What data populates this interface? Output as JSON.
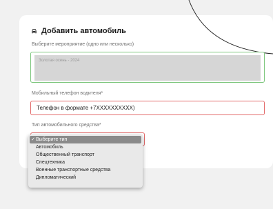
{
  "form": {
    "title": "Добавить автомобиль",
    "title_icon": "car-icon",
    "event_label": "Выберите мероприятие (одно или несколько)",
    "event_options": [
      "Золотая осень - 2024"
    ],
    "phone_label": "Мобильный телефон водителя*",
    "phone_value": "Телефон в формате +7XXXXXXXXXX)",
    "type_label": "Тип автомобильного средства*"
  },
  "dropdown": {
    "check_mark": "✓",
    "items": [
      "Выберите тип",
      "Автомобиль",
      "Общественный транспорт",
      "Спецтехника",
      "Военные транспортные средства",
      "Дипломатический"
    ],
    "selected_index": 0
  },
  "colors": {
    "valid_border": "#7ec77e",
    "error_border": "#e36a6a",
    "page_background": "#f1f1f1"
  }
}
